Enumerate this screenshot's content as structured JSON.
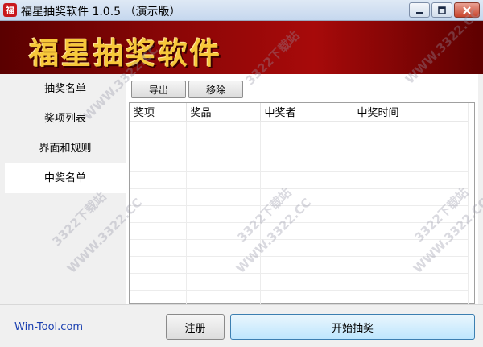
{
  "window": {
    "title": "福星抽奖软件 1.0.5 （演示版）",
    "icon_glyph": "福"
  },
  "banner": {
    "title": "福星抽奖软件",
    "color": "#f7c83a"
  },
  "sidebar": {
    "items": [
      {
        "label": "抽奖名单"
      },
      {
        "label": "奖项列表"
      },
      {
        "label": "界面和规则"
      },
      {
        "label": "中奖名单",
        "active": true
      }
    ]
  },
  "toolbar": {
    "export_label": "导出",
    "remove_label": "移除"
  },
  "table": {
    "columns": [
      "奖项",
      "奖品",
      "中奖者",
      "中奖时间"
    ],
    "rows": []
  },
  "footer": {
    "brand": "Win-Tool.com",
    "register_label": "注册",
    "start_label": "开始抽奖"
  },
  "watermark": {
    "brand_text": "3322下载站",
    "url_text": "WWW.3322.CC"
  },
  "icons": {
    "minimize": "minimize-icon",
    "maximize": "maximize-icon",
    "close": "close-icon"
  }
}
